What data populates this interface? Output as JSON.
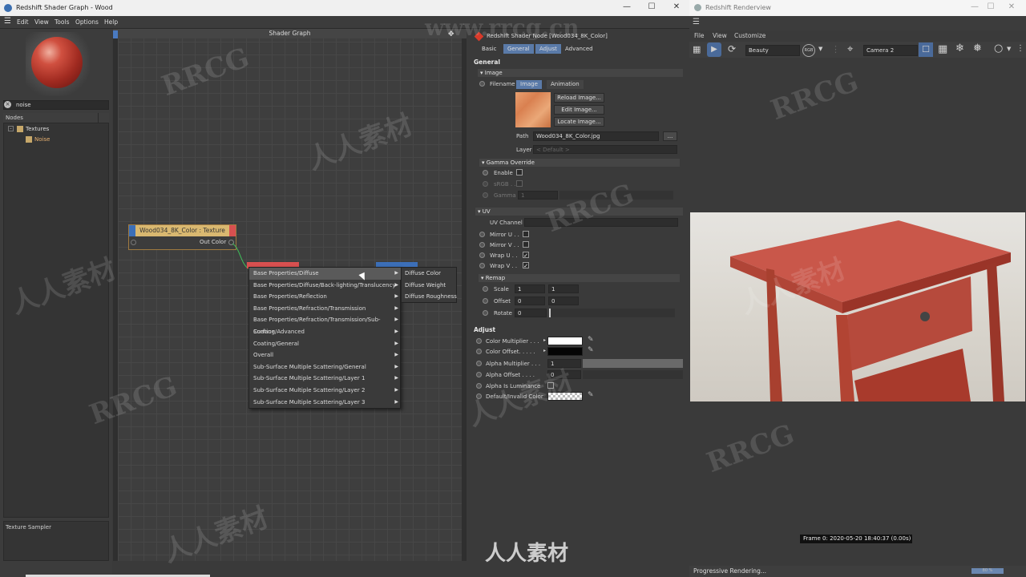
{
  "window": {
    "title": "Redshift Shader Graph - Wood",
    "menu": [
      "Edit",
      "View",
      "Tools",
      "Options",
      "Help"
    ]
  },
  "left_panel": {
    "search_value": "noise",
    "nodes_header": "Nodes",
    "tree": [
      {
        "label": "Textures"
      },
      {
        "label": "Noise"
      }
    ],
    "description": "Texture  Sampler"
  },
  "graph": {
    "title": "Shader Graph",
    "node": {
      "title": "Wood034_8K_Color : Texture",
      "output": "Out Color"
    },
    "context_menu": [
      "Base Properties/Diffuse",
      "Base Properties/Diffuse/Back-lighting/Translucency",
      "Base Properties/Reflection",
      "Base Properties/Refraction/Transmission",
      "Base Properties/Refraction/Transmission/Sub-Surface",
      "Coating/Advanced",
      "Coating/General",
      "Overall",
      "Sub-Surface Multiple Scattering/General",
      "Sub-Surface Multiple Scattering/Layer 1",
      "Sub-Surface Multiple Scattering/Layer 2",
      "Sub-Surface Multiple Scattering/Layer 3"
    ],
    "submenu": [
      "Diffuse Color",
      "Diffuse Weight",
      "Diffuse Roughness"
    ]
  },
  "attributes": {
    "header": "Redshift Shader Node [Wood034_8K_Color]",
    "tabs": [
      "Basic",
      "General",
      "Adjust",
      "Advanced"
    ],
    "section_general": "General",
    "image_group": "Image",
    "filename_label": "Filename",
    "image_tabs": [
      "Image",
      "Animation"
    ],
    "buttons": [
      "Reload Image...",
      "Edit Image...",
      "Locate Image..."
    ],
    "path_label": "Path",
    "path_value": "Wood034_8K_Color.jpg",
    "path_btn": "...",
    "layer_label": "Layer",
    "layer_value": "< Default >",
    "gamma_group": "Gamma Override",
    "enable_label": "Enable",
    "srgb_label": "sRGB . .",
    "gamma_label": "Gamma",
    "gamma_value": "1",
    "uv_group": "UV",
    "uv_channel_label": "UV Channel",
    "mirror_u": "Mirror U . .",
    "mirror_v": "Mirror V . .",
    "wrap_u": "Wrap U . .",
    "wrap_v": "Wrap V . .",
    "remap_group": "Remap",
    "scale_label": "Scale",
    "scale_values": [
      "1",
      "1"
    ],
    "offset_label": "Offset",
    "offset_values": [
      "0",
      "0"
    ],
    "rotate_label": "Rotate",
    "rotate_value": "0",
    "section_adjust": "Adjust",
    "color_multiplier": "Color Multiplier . . .",
    "color_offset": "Color Offset. . . . .",
    "alpha_multiplier": "Alpha Multiplier . . .",
    "alpha_multiplier_value": "1",
    "alpha_offset": "Alpha Offset . . . .",
    "alpha_offset_value": "0",
    "alpha_luminance": "Alpha Is Luminance",
    "default_color": "Default/Invalid Color",
    "accent_color": "#5a7aa8"
  },
  "renderview": {
    "title": "Redshift Renderview",
    "menu": [
      "File",
      "View",
      "Customize"
    ],
    "aov": "Beauty",
    "camera": "Camera 2",
    "frame_info": "Frame  0:  2020-05-20  18:40:37  (0.00s)",
    "status": "Progressive Rendering...",
    "progress_label": "80 %"
  },
  "watermarks": [
    "RRCG",
    "人人素材",
    "www.rrcg.cn"
  ]
}
